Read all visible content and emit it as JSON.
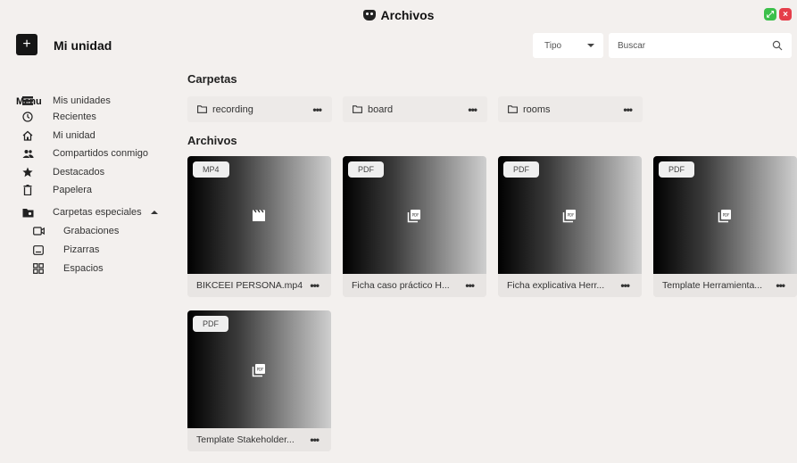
{
  "window": {
    "title": "Archivos"
  },
  "header": {
    "new_label": "+",
    "page_title": "Mi unidad",
    "type_filter": {
      "selected": "Tipo"
    },
    "search": {
      "placeholder": "Buscar",
      "value": ""
    }
  },
  "sidebar": {
    "menu_label": "Menu",
    "items": [
      {
        "label": "Mis unidades",
        "icon": "drives-icon"
      },
      {
        "label": "Recientes",
        "icon": "clock-icon"
      },
      {
        "label": "Mi unidad",
        "icon": "home-icon"
      },
      {
        "label": "Compartidos conmigo",
        "icon": "people-icon"
      },
      {
        "label": "Destacados",
        "icon": "star-icon"
      },
      {
        "label": "Papelera",
        "icon": "trash-icon"
      },
      {
        "label": "Carpetas especiales",
        "icon": "special-folder-icon"
      }
    ],
    "special_items": [
      {
        "label": "Grabaciones",
        "icon": "recording-icon"
      },
      {
        "label": "Pizarras",
        "icon": "whiteboard-icon"
      },
      {
        "label": "Espacios",
        "icon": "spaces-icon"
      }
    ]
  },
  "main": {
    "folders_title": "Carpetas",
    "folders": [
      {
        "name": "recording",
        "menu": "•••"
      },
      {
        "name": "board",
        "menu": "•••"
      },
      {
        "name": "rooms",
        "menu": "•••"
      }
    ],
    "files_title": "Archivos",
    "files": [
      {
        "type": "MP4",
        "name": "BIKCEEI PERSONA.mp4",
        "icon": "video-icon",
        "menu": "•••"
      },
      {
        "type": "PDF",
        "name": "Ficha caso práctico H...",
        "icon": "pdf-icon",
        "menu": "•••"
      },
      {
        "type": "PDF",
        "name": "Ficha explicativa Herr...",
        "icon": "pdf-icon",
        "menu": "•••"
      },
      {
        "type": "PDF",
        "name": "Template Herramienta...",
        "icon": "pdf-icon",
        "menu": "•••"
      },
      {
        "type": "PDF",
        "name": "Template Stakeholder...",
        "icon": "pdf-icon",
        "menu": "•••"
      }
    ]
  },
  "colors": {
    "accent_dark": "#151515",
    "background": "#f3f0ee",
    "green": "#3cc04b",
    "red": "#e53e4a"
  }
}
